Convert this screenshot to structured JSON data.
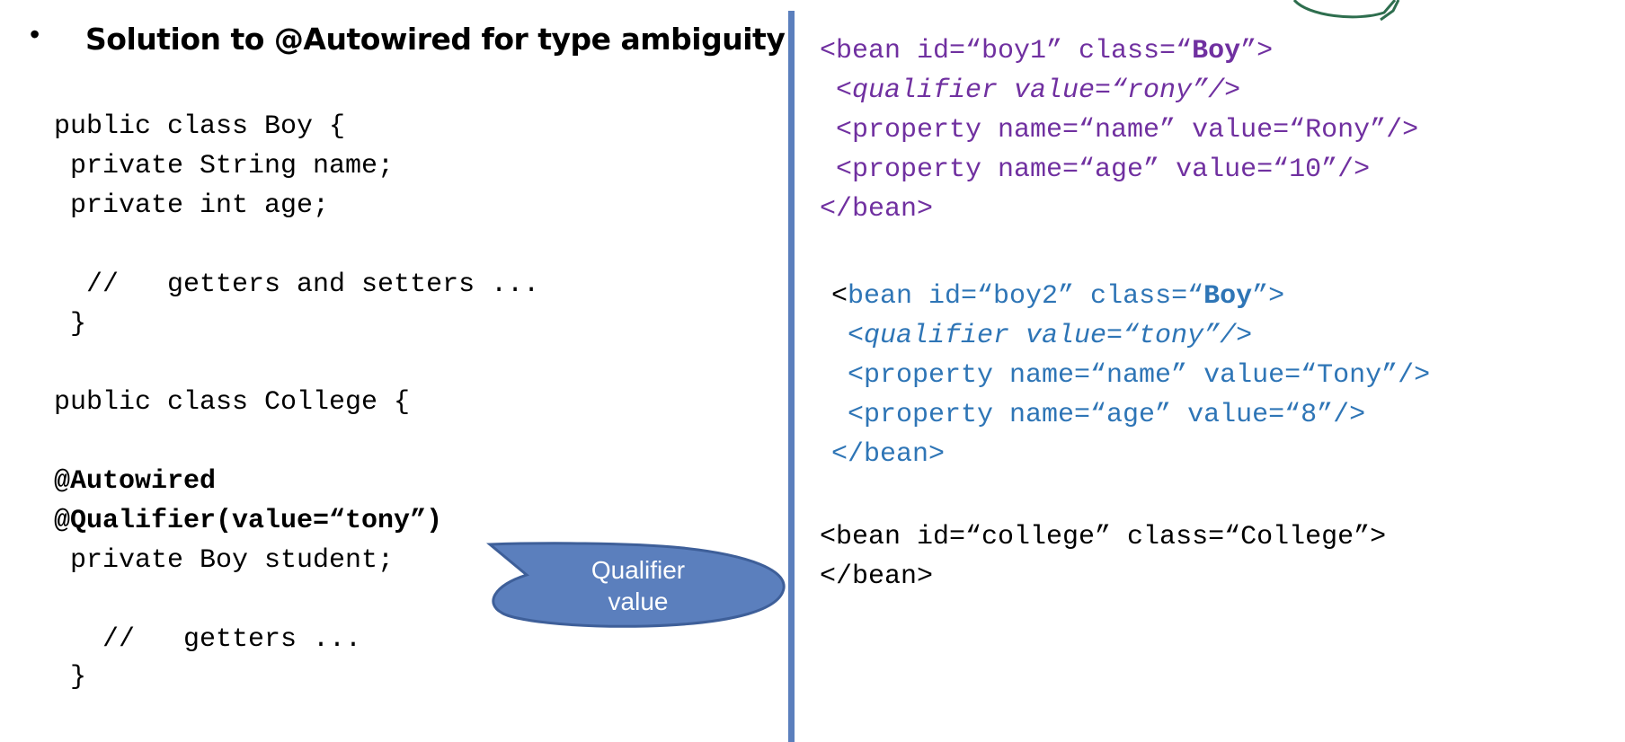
{
  "slide": {
    "bullet": "•",
    "title": "Solution to @Autowired for type ambiguity"
  },
  "left_code": {
    "boy_class_decl": "public class Boy {",
    "boy_field_name": " private String name;",
    "boy_field_age": " private int age;",
    "boy_comment": "  //   getters and setters ...",
    "boy_close": " }",
    "college_class_decl": "public class College {",
    "autowired": "@Autowired",
    "qualifier": "@Qualifier(value=“tony”)",
    "student_field": " private Boy student;",
    "college_comment": "   //   getters ...",
    "college_close": " }"
  },
  "callout": {
    "line1": "Qualifier",
    "line2": "value",
    "fill": "#5b7fbd",
    "stroke": "#3e5f99"
  },
  "right_code": {
    "boy1": {
      "open_pre": "<bean id=“boy1” class=“",
      "class_name": "Boy",
      "open_post": "”>",
      "qualifier": " <qualifier value=“rony”/>",
      "prop_name": " <property name=“name” value=“Rony”/>",
      "prop_age": " <property name=“age” value=“10”/>",
      "close": "</bean>"
    },
    "boy2": {
      "lt": "<",
      "open_pre": "bean id=“boy2” class=“",
      "class_name": "Boy",
      "open_post": "”>",
      "qualifier": " <qualifier value=“tony”/>",
      "prop_name": " <property name=“name” value=“Tony”/>",
      "prop_age": " <property name=“age” value=“8”/>",
      "close": "</bean>"
    },
    "college": {
      "open": "<bean id=“college” class=“College”>",
      "close": "</bean>"
    }
  },
  "colors": {
    "divider": "#5b7fbd",
    "boy1_text": "#7030a0",
    "boy2_text": "#2e75b6",
    "arrow": "#2e6e4e"
  }
}
